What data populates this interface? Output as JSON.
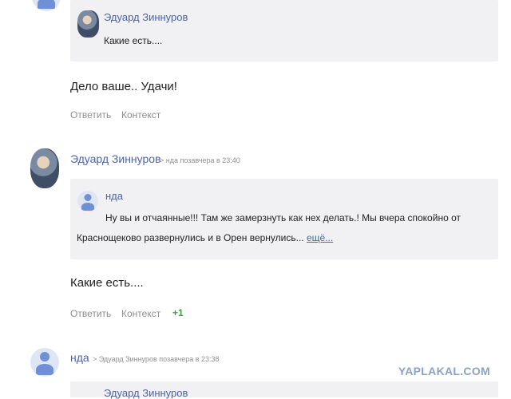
{
  "comments": [
    {
      "quote_author": "Эдуард Зиннуров",
      "quote_text": "Какие есть....",
      "text": "Дело ваше.. Удачи!",
      "actions": {
        "reply": "Ответить",
        "context": "Контекст"
      }
    },
    {
      "author": "Эдуард Зиннуров",
      "meta": "> нда позавчера в 23:40",
      "quote_author": "нда",
      "quote_line1": "Ну вы и отчаянные!!! Там же замерзнуть как нех делать.! Мы вчера спокойно от",
      "quote_line2": "Краснощеково развернулись и в Орен вернулись...",
      "quote_more": "ещё...",
      "text": "Какие есть....",
      "actions": {
        "reply": "Ответить",
        "context": "Контекст",
        "rating": "+1"
      }
    },
    {
      "author": "нда",
      "meta": "> Эдуард Зиннуров позавчера в 23:38",
      "quote_author_partial": "Эдуард Зиннуров"
    }
  ],
  "watermark": "YAPLAKAL.COM",
  "colors": {
    "link": "#4a64a6",
    "meta": "#8f8f8f",
    "quote_bg": "#f1f1f3",
    "plus": "#3e9b3e"
  }
}
